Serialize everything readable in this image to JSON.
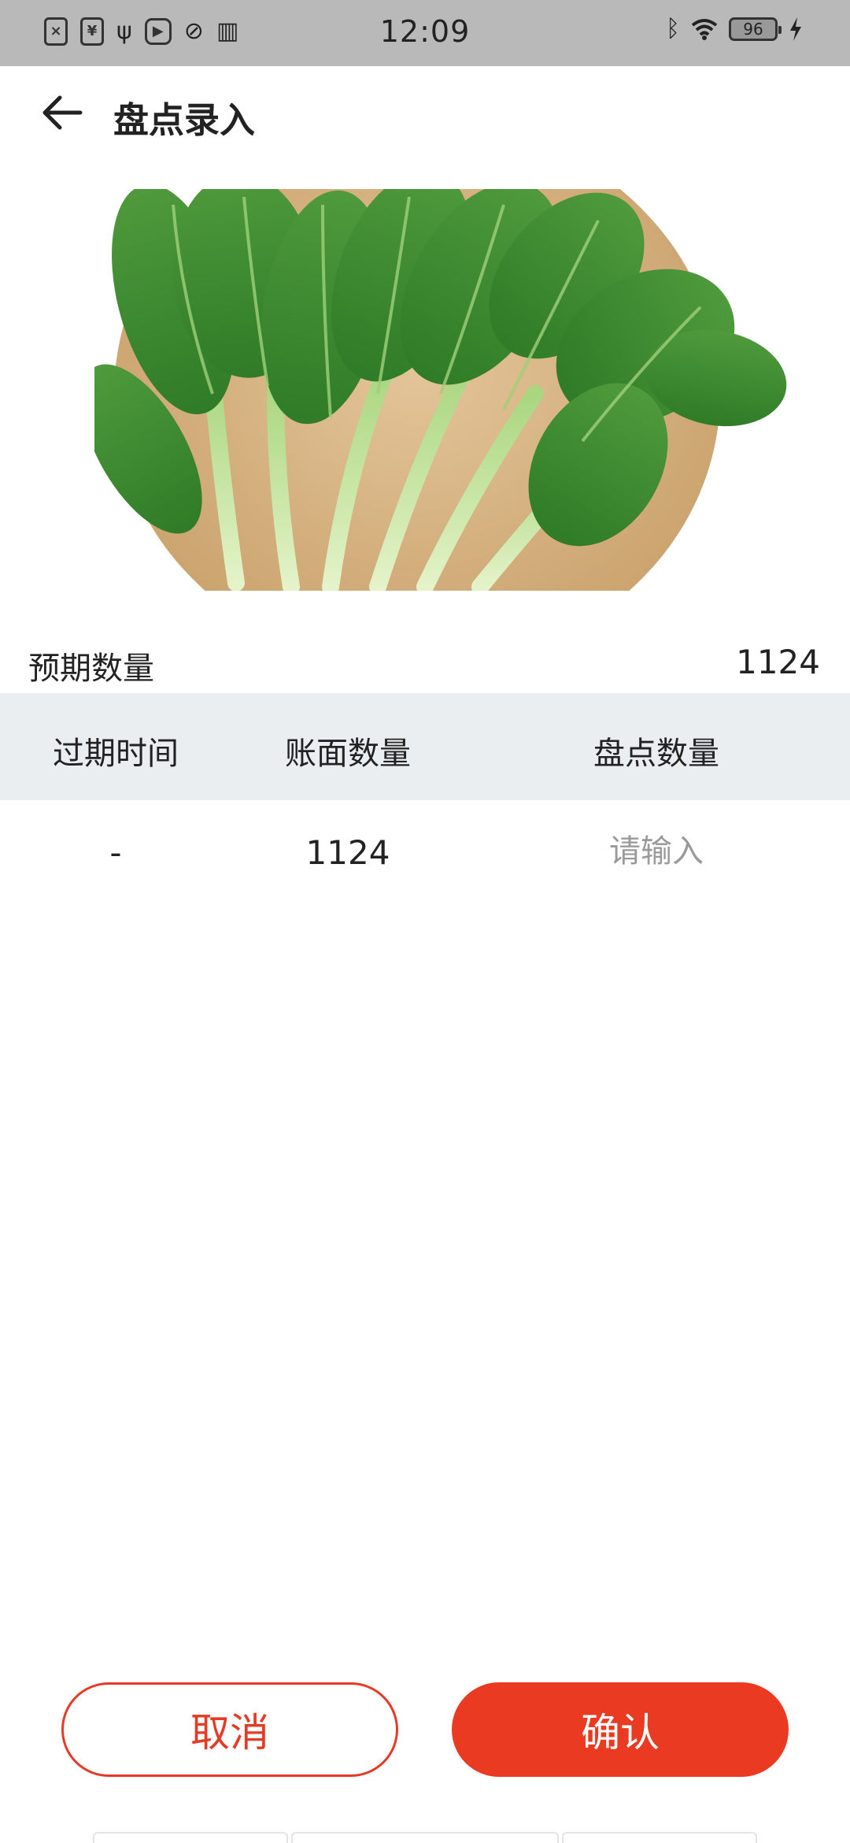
{
  "status_bar": {
    "time": "12:09",
    "battery": "96",
    "left_icons": [
      "sim-error-icon",
      "usb-debug-icon",
      "usb-icon",
      "media-play-icon",
      "link-icon",
      "book-icon"
    ],
    "right_icons": [
      "bluetooth-icon",
      "wifi-icon",
      "battery-icon",
      "charging-icon"
    ]
  },
  "header": {
    "title": "盘点录入",
    "back_icon": "arrow-left-icon"
  },
  "product": {
    "image_icon": "leafy-greens-image"
  },
  "expected": {
    "label": "预期数量",
    "value": "1124"
  },
  "table": {
    "columns": [
      "过期时间",
      "账面数量",
      "盘点数量"
    ],
    "rows": [
      {
        "expiry": "-",
        "book_qty": "1124",
        "count_value": "",
        "count_placeholder": "请输入"
      }
    ]
  },
  "actions": {
    "cancel_label": "取消",
    "confirm_label": "确认"
  },
  "colors": {
    "accent": "#EA3A22",
    "table_header_bg": "#EBEEF1",
    "status_bar_bg": "#B9B9B9"
  }
}
